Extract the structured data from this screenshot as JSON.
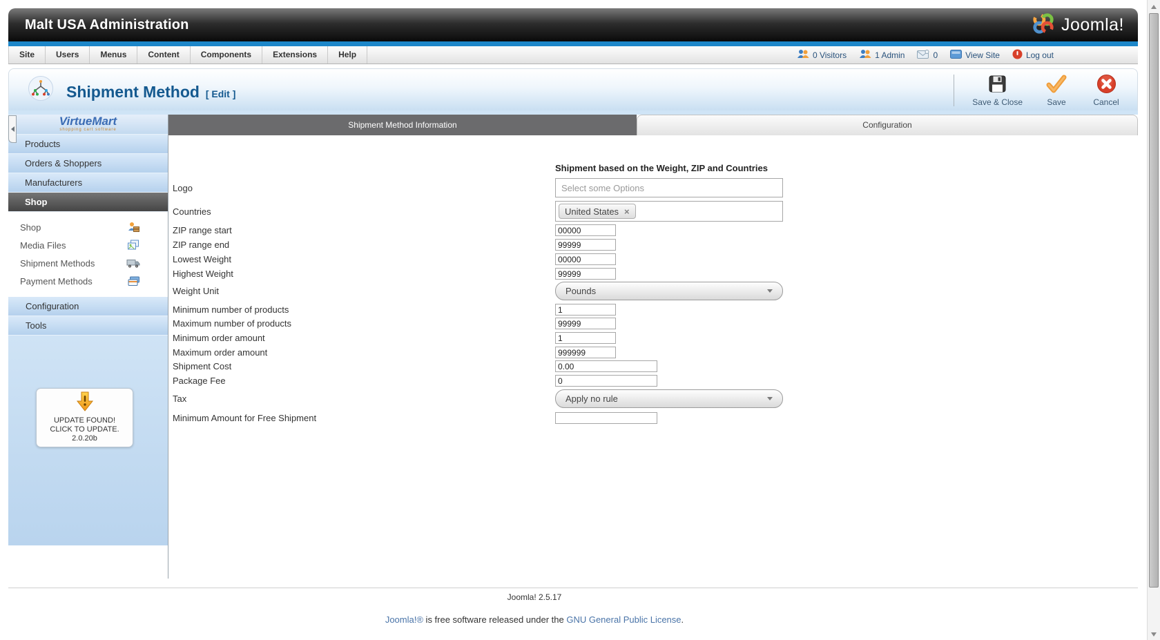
{
  "colors": {
    "accent_blue": "#1d87c9",
    "title_blue": "#14598f",
    "active_tab_gray": "#6b6b6d",
    "sidebar_blue": "#b5d1ed",
    "link_blue": "#4a74a8",
    "cancel_red": "#d8402a",
    "save_orange": "#f09d3a"
  },
  "icons": {
    "joomla-logo-icon": "four-color interlocking rings",
    "page-icon": "circular emblem with colored network dots",
    "save-close-icon": "floppy-disk",
    "save-icon": "orange check-mark",
    "cancel-icon": "red circle with white x",
    "visitors-icon": "two people silhouettes",
    "admin-icon": "two people silhouettes",
    "messages-icon": "envelope",
    "view-site-icon": "blue browser window",
    "logout-icon": "red power circle",
    "shop-icon": "person with box",
    "media-files-icon": "stacked pictures",
    "shipment-methods-icon": "delivery truck",
    "payment-methods-icon": "credit cards",
    "update-arrow-icon": "orange down arrow with exclamation mark",
    "collapse-icon": "left-pointing triangle",
    "select-arrow-icon": "down triangle"
  },
  "titlebar": {
    "app_title": "Malt USA Administration",
    "logo_text": "Joomla!"
  },
  "menubar": {
    "items": [
      "Site",
      "Users",
      "Menus",
      "Content",
      "Components",
      "Extensions",
      "Help"
    ],
    "status": {
      "visitors": "0 Visitors",
      "admin": "1 Admin",
      "messages": "0",
      "view_site": "View Site",
      "logout": "Log out"
    }
  },
  "page_header": {
    "title": "Shipment Method",
    "mode": "[ Edit ]"
  },
  "toolbar": {
    "save_close": "Save & Close",
    "save": "Save",
    "cancel": "Cancel"
  },
  "sidebar": {
    "logo_name": "VirtueMart",
    "logo_tagline": "shopping cart software",
    "menu_top": [
      "Products",
      "Orders & Shoppers",
      "Manufacturers"
    ],
    "menu_active": "Shop",
    "submenu": [
      {
        "label": "Shop",
        "icon": "shop-icon"
      },
      {
        "label": "Media Files",
        "icon": "media-files-icon"
      },
      {
        "label": "Shipment Methods",
        "icon": "shipment-methods-icon"
      },
      {
        "label": "Payment Methods",
        "icon": "payment-methods-icon"
      }
    ],
    "menu_bottom": [
      "Configuration",
      "Tools"
    ],
    "update_box": {
      "line1": "UPDATE FOUND!",
      "line2": "CLICK TO UPDATE.",
      "line3": "2.0.20b"
    }
  },
  "tabs": [
    {
      "label": "Shipment Method Information",
      "active": true
    },
    {
      "label": "Configuration",
      "active": false
    }
  ],
  "form": {
    "section_title": "Shipment based on the Weight, ZIP and Countries",
    "fields": [
      {
        "label": "Logo",
        "type": "multiselect",
        "placeholder": "Select some Options"
      },
      {
        "label": "Countries",
        "type": "tags",
        "tags": [
          {
            "text": "United States",
            "remove": "×"
          }
        ]
      },
      {
        "label": "ZIP range start",
        "type": "text",
        "value": "00000"
      },
      {
        "label": "ZIP range end",
        "type": "text",
        "value": "99999"
      },
      {
        "label": "Lowest Weight",
        "type": "text",
        "value": "00000"
      },
      {
        "label": "Highest Weight",
        "type": "text",
        "value": "99999"
      },
      {
        "label": "Weight Unit",
        "type": "select",
        "value": "Pounds"
      },
      {
        "label": "Minimum number of products",
        "type": "text",
        "value": "1"
      },
      {
        "label": "Maximum number of products",
        "type": "text",
        "value": "99999"
      },
      {
        "label": "Minimum order amount",
        "type": "text",
        "value": "1"
      },
      {
        "label": "Maximum order amount",
        "type": "text",
        "value": "999999"
      },
      {
        "label": "Shipment Cost",
        "type": "text",
        "value": "0.00"
      },
      {
        "label": "Package Fee",
        "type": "text",
        "value": "0"
      },
      {
        "label": "Tax",
        "type": "select",
        "value": "Apply no rule"
      },
      {
        "label": "Minimum Amount for Free Shipment",
        "type": "text",
        "value": ""
      }
    ]
  },
  "footer": {
    "version": "Joomla! 2.5.17",
    "license_link1": "Joomla!®",
    "license_text": " is free software released under the ",
    "license_link2": "GNU General Public License",
    "license_end": "."
  }
}
